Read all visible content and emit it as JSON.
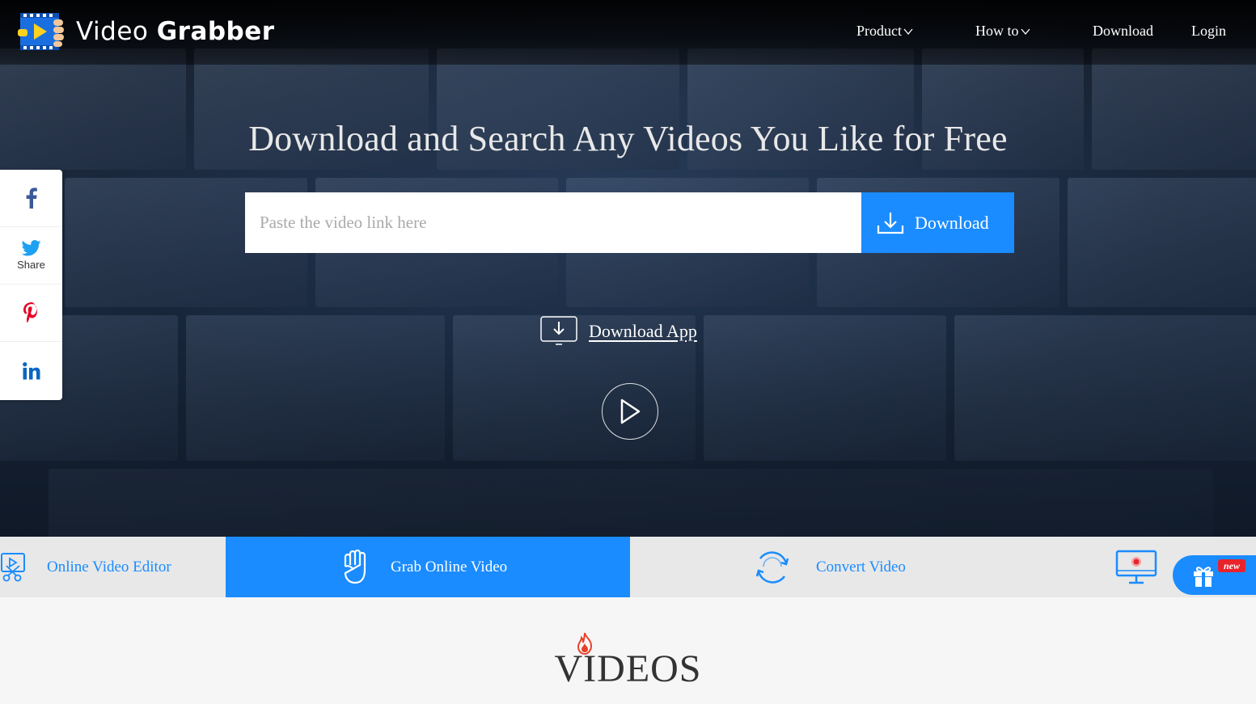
{
  "header": {
    "brand_part1": "Video ",
    "brand_part2": "Grabber",
    "nav": [
      {
        "label": "Product",
        "has_dropdown": true
      },
      {
        "label": "How to",
        "has_dropdown": true
      },
      {
        "label": "Download",
        "has_dropdown": false
      },
      {
        "label": "Login",
        "has_dropdown": false
      }
    ]
  },
  "hero": {
    "title": "Download and Search Any Videos You Like for Free",
    "search_placeholder": "Paste the video link here",
    "search_value": "",
    "download_button": "Download",
    "download_app": "Download App"
  },
  "social": {
    "items": [
      {
        "name": "facebook",
        "icon": "facebook-icon",
        "label": "",
        "color": "#3b5998"
      },
      {
        "name": "twitter",
        "icon": "twitter-icon",
        "label": "Share",
        "color": "#1da1f2"
      },
      {
        "name": "pinterest",
        "icon": "pinterest-icon",
        "label": "",
        "color": "#e60023"
      },
      {
        "name": "linkedin",
        "icon": "linkedin-icon",
        "label": "",
        "color": "#0a66c2"
      }
    ]
  },
  "tabs": [
    {
      "label": "Online Video Editor",
      "icon": "video-editor-icon",
      "active": false
    },
    {
      "label": "Grab Online Video",
      "icon": "grab-hand-icon",
      "active": true
    },
    {
      "label": "Convert Video",
      "icon": "convert-arrows-icon",
      "active": false
    },
    {
      "label": "",
      "icon": "screen-record-icon",
      "active": false
    }
  ],
  "promo": {
    "badge": "new",
    "icon": "gift-icon"
  },
  "videos_section": {
    "title": "VIDEOS",
    "icon": "flame-icon"
  },
  "colors": {
    "accent": "#1a8cff",
    "badge": "#e8232b",
    "tab_bg": "#e8e8e8"
  }
}
